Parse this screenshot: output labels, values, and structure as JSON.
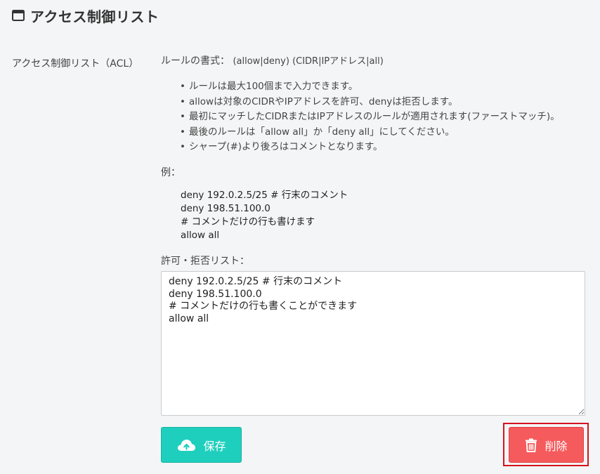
{
  "header": {
    "title": "アクセス制御リスト",
    "icon": "window-icon"
  },
  "field": {
    "label": "アクセス制御リスト（ACL）"
  },
  "format": {
    "label": "ルールの書式：",
    "syntax": "(allow|deny) (CIDR|IPアドレス|all)"
  },
  "rules": [
    "ルールは最大100個まで入力できます。",
    "allowは対象のCIDRやIPアドレスを許可、denyは拒否します。",
    "最初にマッチしたCIDRまたはIPアドレスのルールが適用されます(ファーストマッチ)。",
    "最後のルールは「allow all」か「deny all」にしてください。",
    "シャープ(#)より後ろはコメントとなります。"
  ],
  "example": {
    "label": "例：",
    "lines": [
      "deny 192.0.2.5/25 # 行末のコメント",
      "deny 198.51.100.0",
      "# コメントだけの行も書けます",
      "allow all"
    ]
  },
  "acl_list": {
    "label": "許可・拒否リスト：",
    "value": "deny 192.0.2.5/25 # 行末のコメント\ndeny 198.51.100.0\n# コメントだけの行も書くことができます\nallow all"
  },
  "buttons": {
    "save_label": "保存",
    "save_icon": "cloud-upload-icon",
    "delete_label": "削除",
    "delete_icon": "trash-icon"
  },
  "colors": {
    "save": "#1fcfbd",
    "delete": "#f55a5c",
    "highlight": "#d4141f"
  }
}
